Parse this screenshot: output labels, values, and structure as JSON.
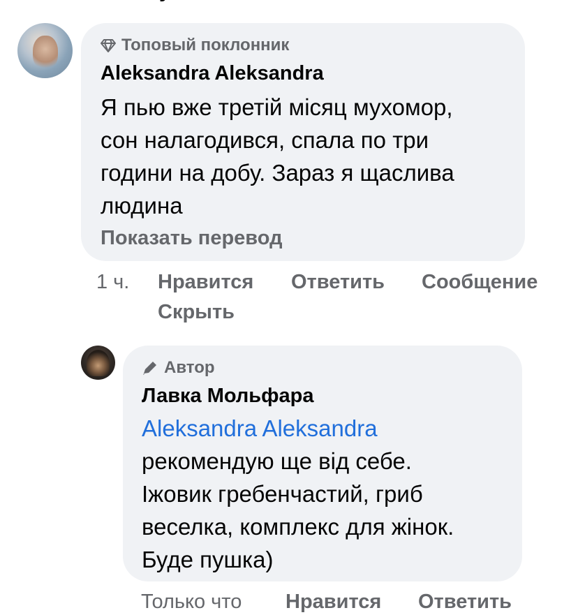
{
  "comment": {
    "badge": "Топовый поклонник",
    "badge_icon": "diamond-icon",
    "author": "Aleksandra Aleksandra",
    "text_lines": [
      "Я пью вже третій місяц мухомор,",
      "сон налагодився, спала по три",
      "години на добу. Зараз я щаслива",
      "людина"
    ],
    "translate_label": "Показать перевод",
    "time": "1 ч.",
    "like_label": "Нравится",
    "reply_label": "Ответить",
    "message_label": "Сообщение",
    "hide_label": "Скрыть"
  },
  "reply": {
    "badge": "Автор",
    "badge_icon": "pencil-icon",
    "author": "Лавка Мольфара",
    "mention": "Aleksandra Aleksandra",
    "text_lines": [
      "рекомендую ще від себе.",
      "Іжовик гребенчастий, гриб",
      "веселка, комплекс для жінок.",
      "Буде пушка)"
    ],
    "time": "Только что",
    "like_label": "Нравится",
    "reply_label": "Ответить"
  },
  "colors": {
    "bubble": "#f0f2f5",
    "secondary_text": "#65676b",
    "primary_text": "#050505",
    "mention": "#216fdb"
  }
}
